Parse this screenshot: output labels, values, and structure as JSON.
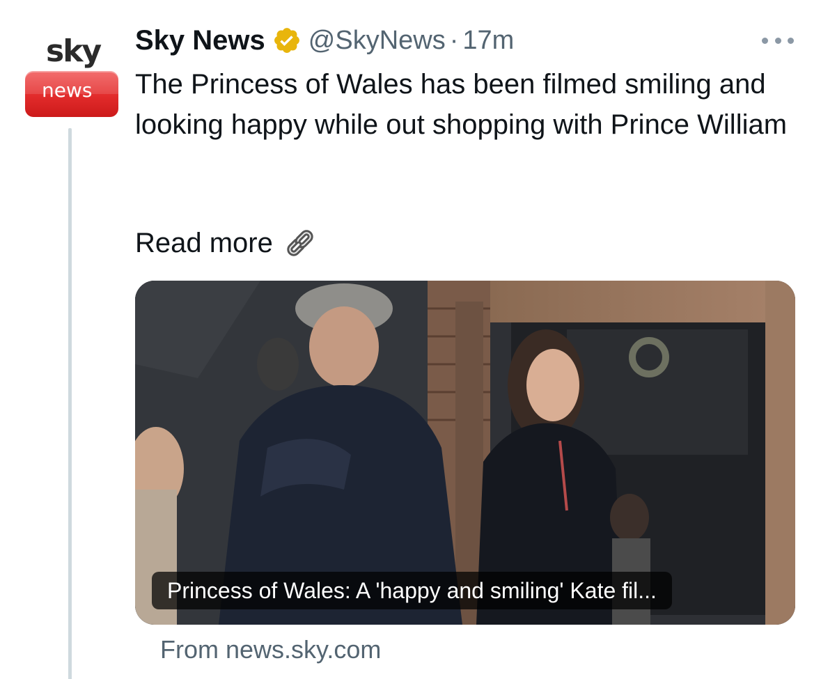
{
  "account": {
    "logo_top": "sky",
    "logo_bottom": "news",
    "display_name": "Sky News",
    "verified_icon": "gold-verified-badge-icon",
    "handle": "@SkyNews",
    "separator": "·",
    "time": "17m",
    "more_icon": "more-options-icon"
  },
  "tweet": {
    "text": "The Princess of Wales has been filmed smiling and looking happy while out shopping with Prince William",
    "read_more": "Read more",
    "read_more_icon": "link-chain-icon"
  },
  "card": {
    "image_alt_icon": "news-photo",
    "caption": "Princess of Wales: A 'happy and smiling' Kate fil...",
    "source": "From news.sky.com"
  },
  "colors": {
    "brand_red": "#e22b2b",
    "verified_gold": "#e8b50c",
    "secondary_text": "#536471",
    "thread_line": "#cfd9de"
  }
}
